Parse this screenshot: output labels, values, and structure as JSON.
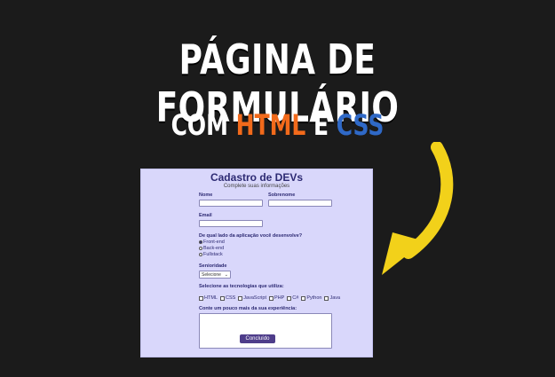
{
  "headline": "PÁGINA DE FORMULÁRIO",
  "subline": {
    "prefix": "COM",
    "html": "HTML",
    "middle": "E",
    "css": "CSS"
  },
  "colors": {
    "background": "#1b1b1b",
    "headline": "#ffffff",
    "html_accent": "#f26a1b",
    "css_accent": "#2f69c7",
    "arrow": "#f2d11a",
    "form_background": "#d9d7fb",
    "form_text": "#2d2a73",
    "button": "#4e3d8a"
  },
  "form": {
    "title": "Cadastro de DEVs",
    "subtitle": "Complete suas informações",
    "fields": {
      "nome_label": "Nome",
      "nome_value": "",
      "sobrenome_label": "Sobrenome",
      "sobrenome_value": "",
      "email_label": "Email",
      "email_value": ""
    },
    "side_question": "De qual lado da aplicação você desenvolve?",
    "side_options": [
      {
        "label": "Front-end",
        "selected": true
      },
      {
        "label": "Back-end",
        "selected": false
      },
      {
        "label": "Fullstack",
        "selected": false
      }
    ],
    "seniority_label": "Senioridade",
    "seniority_selected": "Selecione",
    "tech_question": "Selecione as tecnologias que utiliza:",
    "tech_options": [
      "HTML",
      "CSS",
      "JavaScript",
      "PHP",
      "C#",
      "Python",
      "Java"
    ],
    "experience_label": "Conte um pouco mais da sua experiência:",
    "experience_value": "",
    "submit_label": "Concluído"
  },
  "icons": {
    "arrow": "curved-arrow-icon",
    "select_chevron": "chevron-down-icon"
  }
}
